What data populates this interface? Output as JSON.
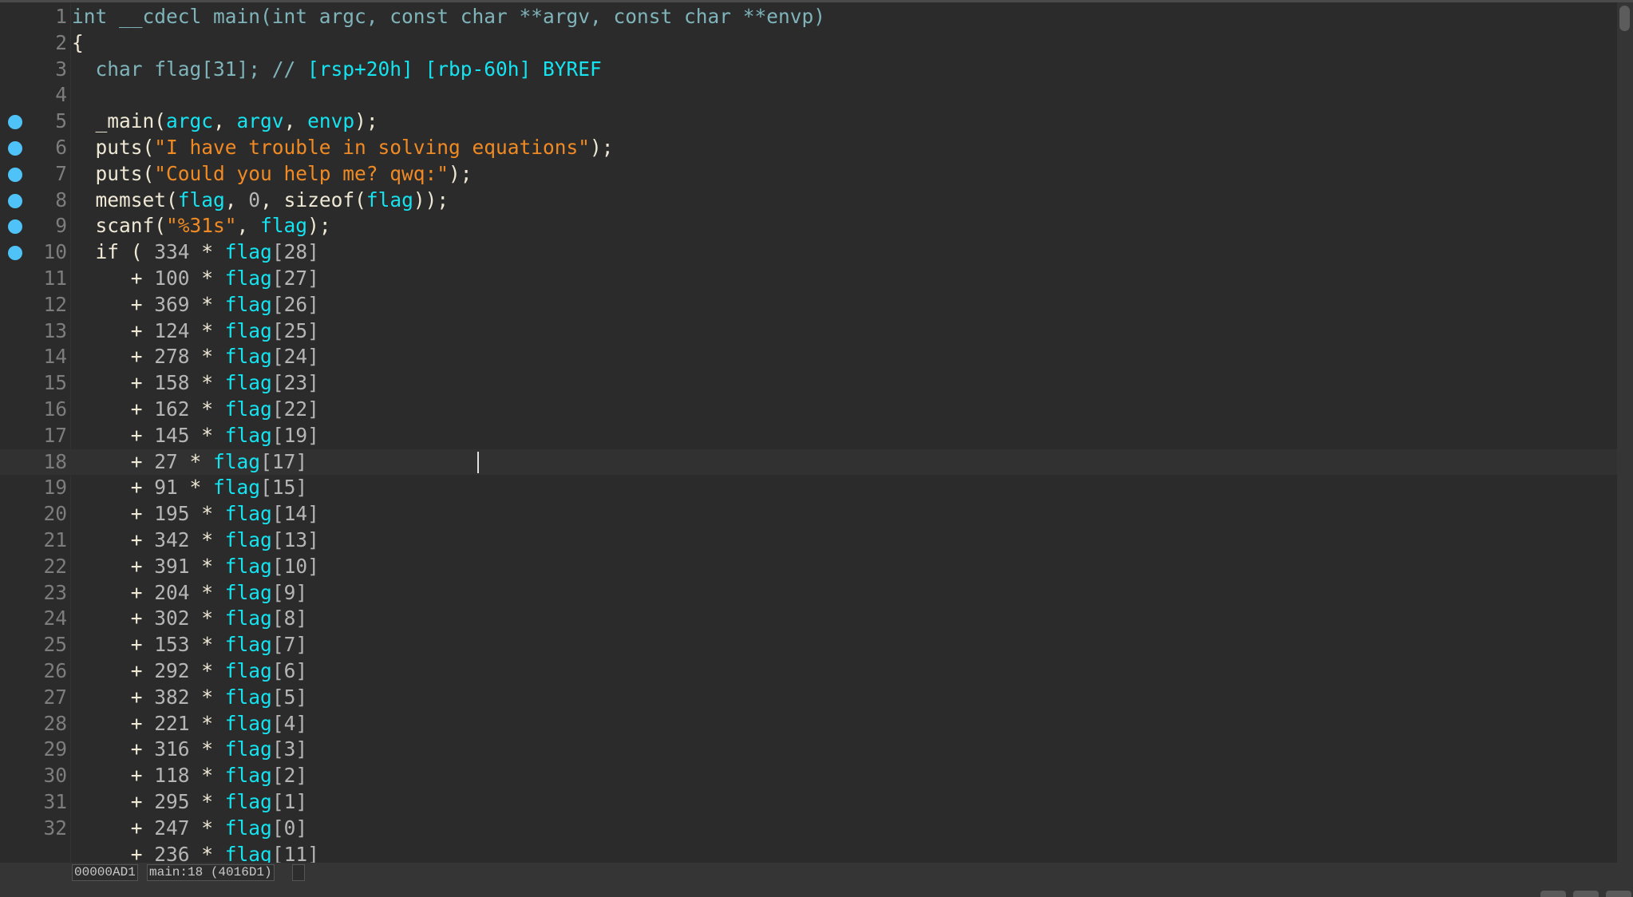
{
  "editor": {
    "lines": [
      {
        "n": "1",
        "tokens": [
          [
            "kw",
            "int __cdecl main(int argc, const char **argv, const char **envp)"
          ]
        ]
      },
      {
        "n": "2",
        "tokens": [
          [
            "fn",
            "{"
          ]
        ]
      },
      {
        "n": "3",
        "tokens": [
          [
            "kw",
            "  char flag[31]; // "
          ],
          [
            "var",
            "[rsp+20h] [rbp-60h] BYREF"
          ]
        ]
      },
      {
        "n": "4",
        "tokens": []
      },
      {
        "n": "5",
        "bp": true,
        "tokens": [
          [
            "fn",
            "  _main("
          ],
          [
            "var",
            "argc"
          ],
          [
            "fn",
            ", "
          ],
          [
            "var",
            "argv"
          ],
          [
            "fn",
            ", "
          ],
          [
            "var",
            "envp"
          ],
          [
            "fn",
            ");"
          ]
        ]
      },
      {
        "n": "6",
        "bp": true,
        "tokens": [
          [
            "fn",
            "  puts("
          ],
          [
            "str",
            "\"I have trouble in solving equations\""
          ],
          [
            "fn",
            ");"
          ]
        ]
      },
      {
        "n": "7",
        "bp": true,
        "tokens": [
          [
            "fn",
            "  puts("
          ],
          [
            "str",
            "\"Could you help me? qwq:\""
          ],
          [
            "fn",
            ");"
          ]
        ]
      },
      {
        "n": "8",
        "bp": true,
        "tokens": [
          [
            "fn",
            "  memset("
          ],
          [
            "var",
            "flag"
          ],
          [
            "fn",
            ", "
          ],
          [
            "num",
            "0"
          ],
          [
            "fn",
            ", sizeof("
          ],
          [
            "var",
            "flag"
          ],
          [
            "fn",
            "));"
          ]
        ]
      },
      {
        "n": "9",
        "bp": true,
        "tokens": [
          [
            "fn",
            "  scanf("
          ],
          [
            "str",
            "\"%31s\""
          ],
          [
            "fn",
            ", "
          ],
          [
            "var",
            "flag"
          ],
          [
            "fn",
            ");"
          ]
        ]
      },
      {
        "n": "10",
        "bp": true,
        "tokens": [
          [
            "fn",
            "  if ( "
          ],
          [
            "num",
            "334"
          ],
          [
            "fn",
            " * "
          ],
          [
            "var",
            "flag"
          ],
          [
            "num",
            "[28]"
          ]
        ]
      },
      {
        "n": "11",
        "tokens": [
          [
            "fn",
            "     + "
          ],
          [
            "num",
            "100"
          ],
          [
            "fn",
            " * "
          ],
          [
            "var",
            "flag"
          ],
          [
            "num",
            "[27]"
          ]
        ]
      },
      {
        "n": "12",
        "tokens": [
          [
            "fn",
            "     + "
          ],
          [
            "num",
            "369"
          ],
          [
            "fn",
            " * "
          ],
          [
            "var",
            "flag"
          ],
          [
            "num",
            "[26]"
          ]
        ]
      },
      {
        "n": "13",
        "tokens": [
          [
            "fn",
            "     + "
          ],
          [
            "num",
            "124"
          ],
          [
            "fn",
            " * "
          ],
          [
            "var",
            "flag"
          ],
          [
            "num",
            "[25]"
          ]
        ]
      },
      {
        "n": "14",
        "tokens": [
          [
            "fn",
            "     + "
          ],
          [
            "num",
            "278"
          ],
          [
            "fn",
            " * "
          ],
          [
            "var",
            "flag"
          ],
          [
            "num",
            "[24]"
          ]
        ]
      },
      {
        "n": "15",
        "tokens": [
          [
            "fn",
            "     + "
          ],
          [
            "num",
            "158"
          ],
          [
            "fn",
            " * "
          ],
          [
            "var",
            "flag"
          ],
          [
            "num",
            "[23]"
          ]
        ]
      },
      {
        "n": "16",
        "tokens": [
          [
            "fn",
            "     + "
          ],
          [
            "num",
            "162"
          ],
          [
            "fn",
            " * "
          ],
          [
            "var",
            "flag"
          ],
          [
            "num",
            "[22]"
          ]
        ]
      },
      {
        "n": "17",
        "tokens": [
          [
            "fn",
            "     + "
          ],
          [
            "num",
            "145"
          ],
          [
            "fn",
            " * "
          ],
          [
            "var",
            "flag"
          ],
          [
            "num",
            "[19]"
          ]
        ]
      },
      {
        "n": "18",
        "current": true,
        "tokens": [
          [
            "fn",
            "     + "
          ],
          [
            "num",
            "27"
          ],
          [
            "fn",
            " * "
          ],
          [
            "var",
            "flag"
          ],
          [
            "num",
            "[17]"
          ]
        ]
      },
      {
        "n": "19",
        "tokens": [
          [
            "fn",
            "     + "
          ],
          [
            "num",
            "91"
          ],
          [
            "fn",
            " * "
          ],
          [
            "var",
            "flag"
          ],
          [
            "num",
            "[15]"
          ]
        ]
      },
      {
        "n": "20",
        "tokens": [
          [
            "fn",
            "     + "
          ],
          [
            "num",
            "195"
          ],
          [
            "fn",
            " * "
          ],
          [
            "var",
            "flag"
          ],
          [
            "num",
            "[14]"
          ]
        ]
      },
      {
        "n": "21",
        "tokens": [
          [
            "fn",
            "     + "
          ],
          [
            "num",
            "342"
          ],
          [
            "fn",
            " * "
          ],
          [
            "var",
            "flag"
          ],
          [
            "num",
            "[13]"
          ]
        ]
      },
      {
        "n": "22",
        "tokens": [
          [
            "fn",
            "     + "
          ],
          [
            "num",
            "391"
          ],
          [
            "fn",
            " * "
          ],
          [
            "var",
            "flag"
          ],
          [
            "num",
            "[10]"
          ]
        ]
      },
      {
        "n": "23",
        "tokens": [
          [
            "fn",
            "     + "
          ],
          [
            "num",
            "204"
          ],
          [
            "fn",
            " * "
          ],
          [
            "var",
            "flag"
          ],
          [
            "num",
            "[9]"
          ]
        ]
      },
      {
        "n": "24",
        "tokens": [
          [
            "fn",
            "     + "
          ],
          [
            "num",
            "302"
          ],
          [
            "fn",
            " * "
          ],
          [
            "var",
            "flag"
          ],
          [
            "num",
            "[8]"
          ]
        ]
      },
      {
        "n": "25",
        "tokens": [
          [
            "fn",
            "     + "
          ],
          [
            "num",
            "153"
          ],
          [
            "fn",
            " * "
          ],
          [
            "var",
            "flag"
          ],
          [
            "num",
            "[7]"
          ]
        ]
      },
      {
        "n": "26",
        "tokens": [
          [
            "fn",
            "     + "
          ],
          [
            "num",
            "292"
          ],
          [
            "fn",
            " * "
          ],
          [
            "var",
            "flag"
          ],
          [
            "num",
            "[6]"
          ]
        ]
      },
      {
        "n": "27",
        "tokens": [
          [
            "fn",
            "     + "
          ],
          [
            "num",
            "382"
          ],
          [
            "fn",
            " * "
          ],
          [
            "var",
            "flag"
          ],
          [
            "num",
            "[5]"
          ]
        ]
      },
      {
        "n": "28",
        "tokens": [
          [
            "fn",
            "     + "
          ],
          [
            "num",
            "221"
          ],
          [
            "fn",
            " * "
          ],
          [
            "var",
            "flag"
          ],
          [
            "num",
            "[4]"
          ]
        ]
      },
      {
        "n": "29",
        "tokens": [
          [
            "fn",
            "     + "
          ],
          [
            "num",
            "316"
          ],
          [
            "fn",
            " * "
          ],
          [
            "var",
            "flag"
          ],
          [
            "num",
            "[3]"
          ]
        ]
      },
      {
        "n": "30",
        "tokens": [
          [
            "fn",
            "     + "
          ],
          [
            "num",
            "118"
          ],
          [
            "fn",
            " * "
          ],
          [
            "var",
            "flag"
          ],
          [
            "num",
            "[2]"
          ]
        ]
      },
      {
        "n": "31",
        "tokens": [
          [
            "fn",
            "     + "
          ],
          [
            "num",
            "295"
          ],
          [
            "fn",
            " * "
          ],
          [
            "var",
            "flag"
          ],
          [
            "num",
            "[1]"
          ]
        ]
      },
      {
        "n": "32",
        "tokens": [
          [
            "fn",
            "     + "
          ],
          [
            "num",
            "247"
          ],
          [
            "fn",
            " * "
          ],
          [
            "var",
            "flag"
          ],
          [
            "num",
            "[0]"
          ]
        ]
      },
      {
        "n": "",
        "tokens": [
          [
            "fn",
            "     + "
          ],
          [
            "num",
            "236"
          ],
          [
            "fn",
            " * "
          ],
          [
            "var",
            "flag"
          ],
          [
            "num",
            "[11]"
          ]
        ]
      }
    ]
  },
  "status": {
    "address": "00000AD1",
    "location": "main:18 (4016D1)",
    "extra": ""
  },
  "colors": {
    "breakpoint": "#4fc3f7",
    "variable": "#16e3f0",
    "string": "#f08a24"
  }
}
